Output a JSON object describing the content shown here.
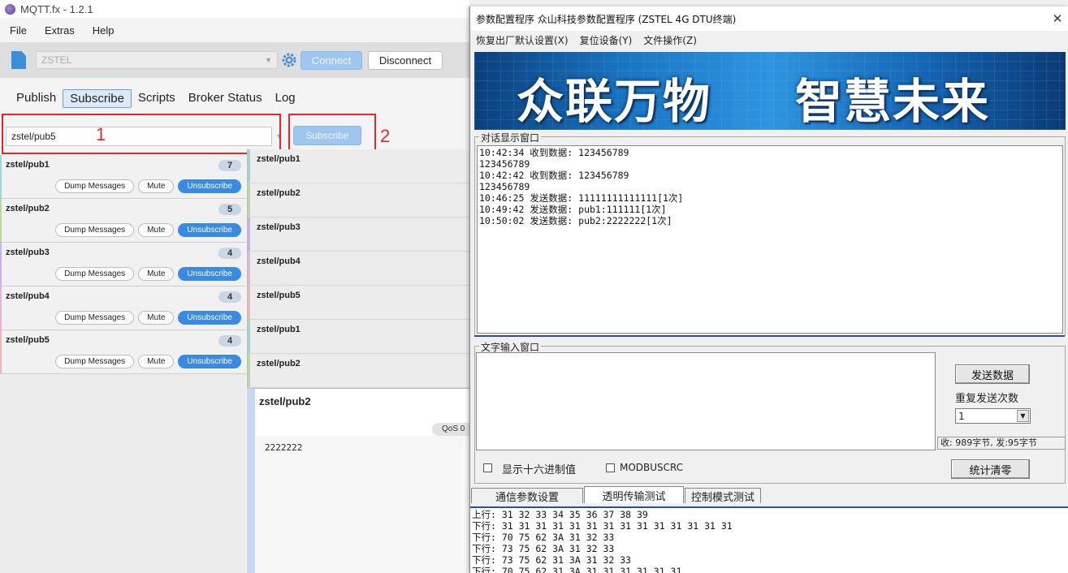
{
  "mqtt": {
    "title": "MQTT.fx - 1.2.1",
    "menu": [
      "File",
      "Extras",
      "Help"
    ],
    "profile": "ZSTEL",
    "connect_label": "Connect",
    "disconnect_label": "Disconnect",
    "tabs": [
      "Publish",
      "Subscribe",
      "Scripts",
      "Broker Status",
      "Log"
    ],
    "topic_value": "zstel/pub5",
    "subscribe_label": "Subscribe",
    "annotation_1": "1",
    "annotation_2": "2",
    "subscriptions": [
      {
        "topic": "zstel/pub1",
        "count": "7"
      },
      {
        "topic": "zstel/pub2",
        "count": "5"
      },
      {
        "topic": "zstel/pub3",
        "count": "4"
      },
      {
        "topic": "zstel/pub4",
        "count": "4"
      },
      {
        "topic": "zstel/pub5",
        "count": "4"
      }
    ],
    "sub_actions": {
      "dump": "Dump Messages",
      "mute": "Mute",
      "unsubscribe": "Unsubscribe"
    },
    "messages": [
      "zstel/pub1",
      "zstel/pub2",
      "zstel/pub3",
      "zstel/pub4",
      "zstel/pub5",
      "zstel/pub1",
      "zstel/pub2"
    ],
    "detail": {
      "topic": "zstel/pub2",
      "qos": "QoS 0",
      "payload": "2222222"
    }
  },
  "dtu": {
    "title": "参数配置程序  众山科技参数配置程序 (ZSTEL 4G DTU终端)",
    "menu": [
      "恢复出厂默认设置(X)",
      "复位设备(Y)",
      "文件操作(Z)"
    ],
    "banner_left": "众联万物",
    "banner_right": "智慧未来",
    "dialog_label": "对话显示窗口",
    "dialog_log": "10:42:34 收到数据: 123456789\n123456789\n10:42:42 收到数据: 123456789\n123456789\n10:46:25 发送数据: 11111111111111[1次]\n10:49:42 发送数据: pub1:111111[1次]\n10:50:02 发送数据: pub2:2222222[1次]",
    "input_label": "文字输入窗口",
    "send_label": "发送数据",
    "repeat_label": "重复发送次数",
    "repeat_value": "1",
    "stats": "收: 989字节, 发:95字节",
    "hex_label": "显示十六进制值",
    "modbus_label": "MODBUSCRC",
    "clear_label": "统计清零",
    "bottom_tabs": [
      "通信参数设置",
      "透明传输测试",
      "控制模式测试"
    ],
    "bottom_log": "上行: 31 32 33 34 35 36 37 38 39\n下行: 31 31 31 31 31 31 31 31 31 31 31 31 31 31\n下行: 70 75 62 3A 31 32 33\n下行: 73 75 62 3A 31 32 33\n下行: 73 75 62 31 3A 31 32 33\n下行: 70 75 62 31 3A 31 31 31 31 31 31"
  }
}
